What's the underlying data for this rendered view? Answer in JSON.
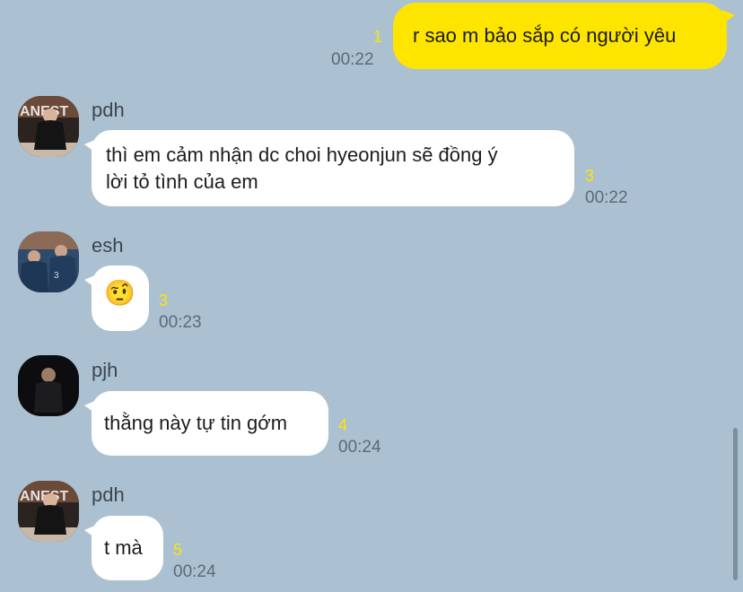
{
  "messages": [
    {
      "direction": "out",
      "text": "r sao m bảo sắp có người yêu",
      "unread": "1",
      "time": "00:22"
    },
    {
      "direction": "in",
      "sender": "pdh",
      "text_lines": [
        "thì em cảm nhận dc choi hyeonjun sẽ đồng ý",
        "lời tỏ tình của em"
      ],
      "unread": "3",
      "time": "00:22"
    },
    {
      "direction": "in",
      "sender": "esh",
      "emoji": "🤨",
      "unread": "3",
      "time": "00:23"
    },
    {
      "direction": "in",
      "sender": "pjh",
      "text": "thằng này tự tin gớm",
      "unread": "4",
      "time": "00:24"
    },
    {
      "direction": "in",
      "sender": "pdh",
      "text": "t mà",
      "unread": "5",
      "time": "00:24"
    }
  ],
  "colors": {
    "background": "#abc1d1",
    "outgoing_bubble": "#fee500",
    "incoming_bubble": "#ffffff",
    "unread_count": "#fee500"
  }
}
